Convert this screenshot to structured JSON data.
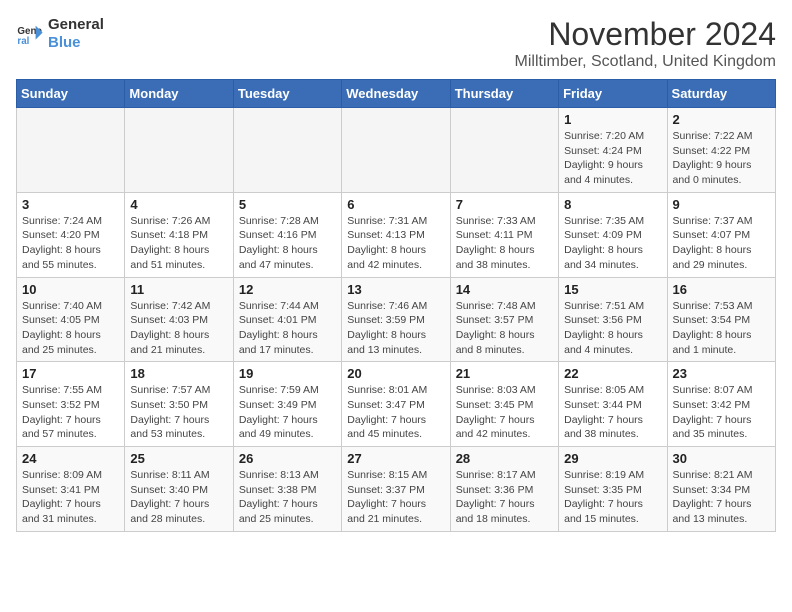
{
  "logo": {
    "line1": "General",
    "line2": "Blue"
  },
  "title": "November 2024",
  "subtitle": "Milltimber, Scotland, United Kingdom",
  "headers": [
    "Sunday",
    "Monday",
    "Tuesday",
    "Wednesday",
    "Thursday",
    "Friday",
    "Saturday"
  ],
  "weeks": [
    [
      {
        "day": "",
        "info": ""
      },
      {
        "day": "",
        "info": ""
      },
      {
        "day": "",
        "info": ""
      },
      {
        "day": "",
        "info": ""
      },
      {
        "day": "",
        "info": ""
      },
      {
        "day": "1",
        "info": "Sunrise: 7:20 AM\nSunset: 4:24 PM\nDaylight: 9 hours\nand 4 minutes."
      },
      {
        "day": "2",
        "info": "Sunrise: 7:22 AM\nSunset: 4:22 PM\nDaylight: 9 hours\nand 0 minutes."
      }
    ],
    [
      {
        "day": "3",
        "info": "Sunrise: 7:24 AM\nSunset: 4:20 PM\nDaylight: 8 hours\nand 55 minutes."
      },
      {
        "day": "4",
        "info": "Sunrise: 7:26 AM\nSunset: 4:18 PM\nDaylight: 8 hours\nand 51 minutes."
      },
      {
        "day": "5",
        "info": "Sunrise: 7:28 AM\nSunset: 4:16 PM\nDaylight: 8 hours\nand 47 minutes."
      },
      {
        "day": "6",
        "info": "Sunrise: 7:31 AM\nSunset: 4:13 PM\nDaylight: 8 hours\nand 42 minutes."
      },
      {
        "day": "7",
        "info": "Sunrise: 7:33 AM\nSunset: 4:11 PM\nDaylight: 8 hours\nand 38 minutes."
      },
      {
        "day": "8",
        "info": "Sunrise: 7:35 AM\nSunset: 4:09 PM\nDaylight: 8 hours\nand 34 minutes."
      },
      {
        "day": "9",
        "info": "Sunrise: 7:37 AM\nSunset: 4:07 PM\nDaylight: 8 hours\nand 29 minutes."
      }
    ],
    [
      {
        "day": "10",
        "info": "Sunrise: 7:40 AM\nSunset: 4:05 PM\nDaylight: 8 hours\nand 25 minutes."
      },
      {
        "day": "11",
        "info": "Sunrise: 7:42 AM\nSunset: 4:03 PM\nDaylight: 8 hours\nand 21 minutes."
      },
      {
        "day": "12",
        "info": "Sunrise: 7:44 AM\nSunset: 4:01 PM\nDaylight: 8 hours\nand 17 minutes."
      },
      {
        "day": "13",
        "info": "Sunrise: 7:46 AM\nSunset: 3:59 PM\nDaylight: 8 hours\nand 13 minutes."
      },
      {
        "day": "14",
        "info": "Sunrise: 7:48 AM\nSunset: 3:57 PM\nDaylight: 8 hours\nand 8 minutes."
      },
      {
        "day": "15",
        "info": "Sunrise: 7:51 AM\nSunset: 3:56 PM\nDaylight: 8 hours\nand 4 minutes."
      },
      {
        "day": "16",
        "info": "Sunrise: 7:53 AM\nSunset: 3:54 PM\nDaylight: 8 hours\nand 1 minute."
      }
    ],
    [
      {
        "day": "17",
        "info": "Sunrise: 7:55 AM\nSunset: 3:52 PM\nDaylight: 7 hours\nand 57 minutes."
      },
      {
        "day": "18",
        "info": "Sunrise: 7:57 AM\nSunset: 3:50 PM\nDaylight: 7 hours\nand 53 minutes."
      },
      {
        "day": "19",
        "info": "Sunrise: 7:59 AM\nSunset: 3:49 PM\nDaylight: 7 hours\nand 49 minutes."
      },
      {
        "day": "20",
        "info": "Sunrise: 8:01 AM\nSunset: 3:47 PM\nDaylight: 7 hours\nand 45 minutes."
      },
      {
        "day": "21",
        "info": "Sunrise: 8:03 AM\nSunset: 3:45 PM\nDaylight: 7 hours\nand 42 minutes."
      },
      {
        "day": "22",
        "info": "Sunrise: 8:05 AM\nSunset: 3:44 PM\nDaylight: 7 hours\nand 38 minutes."
      },
      {
        "day": "23",
        "info": "Sunrise: 8:07 AM\nSunset: 3:42 PM\nDaylight: 7 hours\nand 35 minutes."
      }
    ],
    [
      {
        "day": "24",
        "info": "Sunrise: 8:09 AM\nSunset: 3:41 PM\nDaylight: 7 hours\nand 31 minutes."
      },
      {
        "day": "25",
        "info": "Sunrise: 8:11 AM\nSunset: 3:40 PM\nDaylight: 7 hours\nand 28 minutes."
      },
      {
        "day": "26",
        "info": "Sunrise: 8:13 AM\nSunset: 3:38 PM\nDaylight: 7 hours\nand 25 minutes."
      },
      {
        "day": "27",
        "info": "Sunrise: 8:15 AM\nSunset: 3:37 PM\nDaylight: 7 hours\nand 21 minutes."
      },
      {
        "day": "28",
        "info": "Sunrise: 8:17 AM\nSunset: 3:36 PM\nDaylight: 7 hours\nand 18 minutes."
      },
      {
        "day": "29",
        "info": "Sunrise: 8:19 AM\nSunset: 3:35 PM\nDaylight: 7 hours\nand 15 minutes."
      },
      {
        "day": "30",
        "info": "Sunrise: 8:21 AM\nSunset: 3:34 PM\nDaylight: 7 hours\nand 13 minutes."
      }
    ]
  ]
}
